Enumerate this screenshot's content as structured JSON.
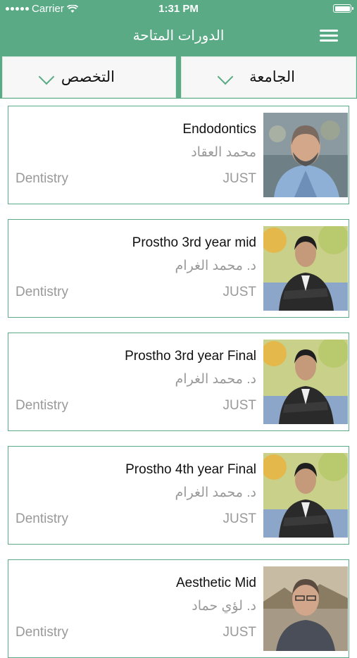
{
  "status": {
    "carrier": "Carrier",
    "time": "1:31 PM"
  },
  "header": {
    "title": "الدورات المتاحة",
    "menu_icon": "hamburger-menu-icon"
  },
  "filters": {
    "major_label": "التخصص",
    "university_label": "الجامعة"
  },
  "courses": [
    {
      "name": "Endodontics",
      "instructor": "محمد العقاد",
      "university": "JUST",
      "major": "Dentistry"
    },
    {
      "name": "Prostho 3rd year mid",
      "instructor": "د. محمد الغرام",
      "university": "JUST",
      "major": "Dentistry"
    },
    {
      "name": "Prostho 3rd year Final",
      "instructor": "د. محمد الغرام",
      "university": "JUST",
      "major": "Dentistry"
    },
    {
      "name": "Prostho 4th year Final",
      "instructor": "د. محمد الغرام",
      "university": "JUST",
      "major": "Dentistry"
    },
    {
      "name": "Aesthetic Mid",
      "instructor": "د. لؤي حماد",
      "university": "JUST",
      "major": "Dentistry"
    }
  ]
}
